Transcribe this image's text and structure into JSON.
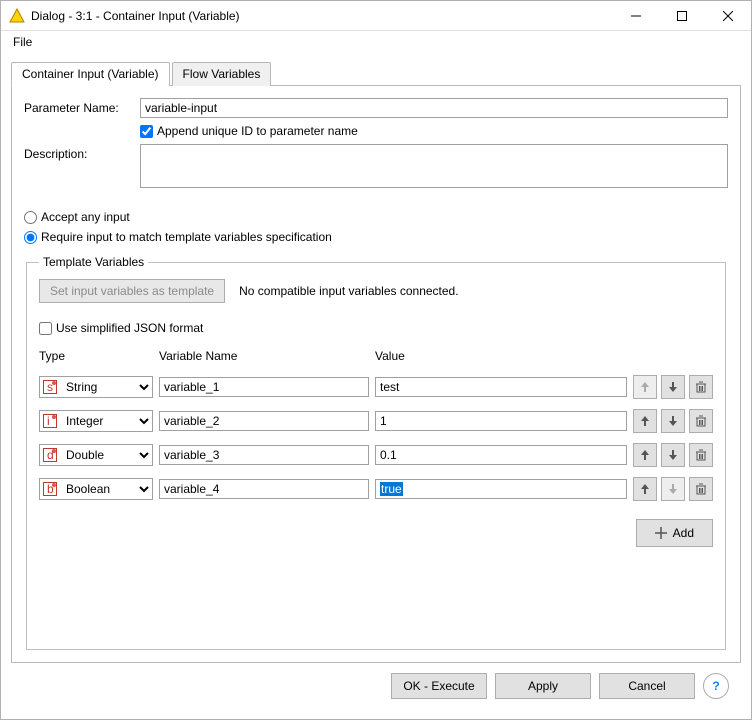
{
  "window": {
    "title": "Dialog - 3:1 - Container Input (Variable)"
  },
  "menubar": {
    "file": "File"
  },
  "tabs": {
    "container": "Container Input (Variable)",
    "flow": "Flow Variables"
  },
  "form": {
    "param_label": "Parameter Name:",
    "param_value": "variable-input",
    "append_label": "Append unique ID to parameter name",
    "desc_label": "Description:",
    "desc_value": ""
  },
  "radios": {
    "accept": "Accept any input",
    "require": "Require input to match template variables specification"
  },
  "group": {
    "legend": "Template Variables",
    "set_template_btn": "Set input variables as template",
    "hint": "No compatible input variables connected.",
    "simplified": "Use simplified JSON format",
    "headers": {
      "type": "Type",
      "name": "Variable Name",
      "value": "Value"
    },
    "type_options": [
      "String",
      "Integer",
      "Double",
      "Boolean"
    ],
    "rows": [
      {
        "type": "String",
        "type_letter": "s",
        "name": "variable_1",
        "value": "test",
        "selected": false
      },
      {
        "type": "Integer",
        "type_letter": "i",
        "name": "variable_2",
        "value": "1",
        "selected": false
      },
      {
        "type": "Double",
        "type_letter": "d",
        "name": "variable_3",
        "value": "0.1",
        "selected": false
      },
      {
        "type": "Boolean",
        "type_letter": "b",
        "name": "variable_4",
        "value": "true",
        "selected": true
      }
    ],
    "add_btn": "Add"
  },
  "footer": {
    "ok": "OK - Execute",
    "apply": "Apply",
    "cancel": "Cancel"
  }
}
